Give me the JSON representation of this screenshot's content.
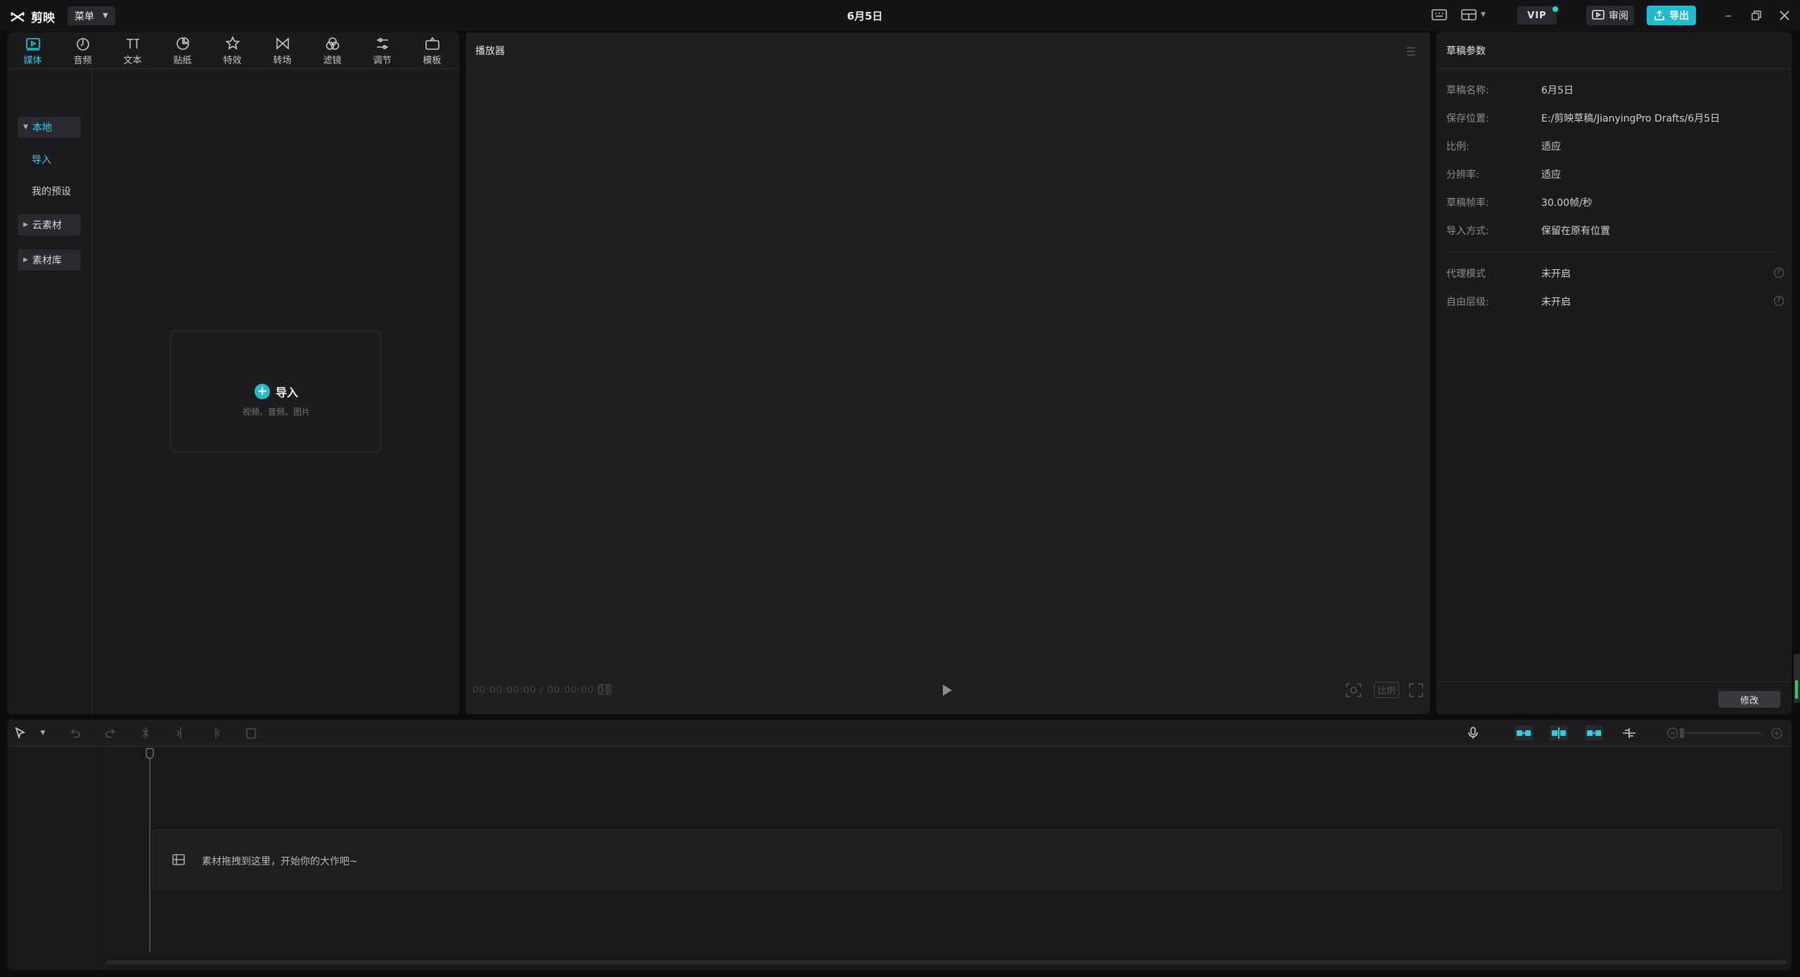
{
  "app": {
    "name": "剪映",
    "menu_label": "菜单",
    "doc_title": "6月5日",
    "vip_label": "VIP",
    "review_label": "审阅",
    "export_label": "导出"
  },
  "tool_tabs": [
    {
      "label": "媒体",
      "icon": "media-icon",
      "active": true
    },
    {
      "label": "音频",
      "icon": "audio-icon",
      "active": false
    },
    {
      "label": "文本",
      "icon": "text-icon",
      "active": false
    },
    {
      "label": "贴纸",
      "icon": "sticker-icon",
      "active": false
    },
    {
      "label": "特效",
      "icon": "effects-icon",
      "active": false
    },
    {
      "label": "转场",
      "icon": "transition-icon",
      "active": false
    },
    {
      "label": "滤镜",
      "icon": "filter-icon",
      "active": false
    },
    {
      "label": "调节",
      "icon": "adjust-icon",
      "active": false
    },
    {
      "label": "模板",
      "icon": "template-icon",
      "active": false
    }
  ],
  "side_nav": {
    "local": "本地",
    "import": "导入",
    "my_presets": "我的预设",
    "cloud": "云素材",
    "library": "素材库"
  },
  "import_card": {
    "label": "导入",
    "hint": "视频、音频、图片"
  },
  "player": {
    "title": "播放器",
    "current_time": "00:00:00:00",
    "total_time": "00:00:00:00",
    "ratio_label": "比例"
  },
  "props": {
    "title": "草稿参数",
    "rows": [
      {
        "label": "草稿名称:",
        "value": "6月5日"
      },
      {
        "label": "保存位置:",
        "value": "E:/剪映草稿/JianyingPro Drafts/6月5日"
      },
      {
        "label": "比例:",
        "value": "适应"
      },
      {
        "label": "分辨率:",
        "value": "适应"
      },
      {
        "label": "草稿帧率:",
        "value": "30.00帧/秒"
      },
      {
        "label": "导入方式:",
        "value": "保留在原有位置"
      }
    ],
    "extra_rows": [
      {
        "label": "代理模式",
        "value": "未开启"
      },
      {
        "label": "自由层级:",
        "value": "未开启"
      }
    ],
    "modify_label": "修改"
  },
  "timeline": {
    "drop_hint": "素材拖拽到这里，开始你的大作吧~"
  },
  "colors": {
    "accent": "#22d3e6",
    "export_bg": "#1fbccd",
    "panel_bg": "#1b1b1d",
    "app_bg": "#0d0d0f"
  }
}
